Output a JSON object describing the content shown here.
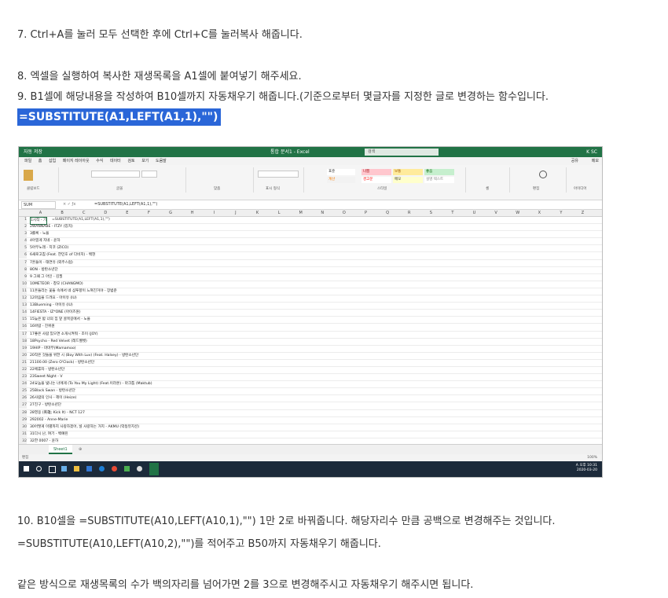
{
  "paragraphs": {
    "step7": "7. Ctrl+A를 눌러 모두 선택한 후에 Ctrl+C를 눌러복사 해줍니다.",
    "step8": "8. 엑셀을 실행하여 복사한 재생목록을 A1셀에 붙여넣기 해주세요.",
    "step9": "9. B1셀에 해당내용을 작성하여 B10셀까지 자동채우기 해줍니다.(기준으로부터 몇글자를 지정한 글로 변경하는 함수입니다.",
    "formula": "=SUBSTITUTE(A1,LEFT(A1,1),\"\")",
    "step10a": "10. B10셀을 =SUBSTITUTE(A10,LEFT(A10,1),\"\") 1만 2로 바꿔줍니다. 해당자리수 만큼 공백으로 변경해주는 것입니다.",
    "step10b": "=SUBSTITUTE(A10,LEFT(A10,2),\"\")를 적어주고 B50까지 자동채우기 해줍니다.",
    "step11": "같은 방식으로 재생목록의 수가 백의자리를 넘어가면 2를 3으로 변경해주시고 자동채우기 해주시면 됩니다."
  },
  "excel": {
    "autosave": "자동 저장",
    "window_title": "통합 문서1 - Excel",
    "search_placeholder": "검색",
    "user": "K SC",
    "menu": [
      "파일",
      "홈",
      "삽입",
      "페이지 레이아웃",
      "수식",
      "데이터",
      "검토",
      "보기",
      "도움말"
    ],
    "share": "공유",
    "memo": "메모",
    "ribbon_groups": [
      "클립보드",
      "글꼴",
      "맞춤",
      "표시 형식",
      "스타일",
      "셀",
      "편집",
      "아이디어"
    ],
    "style_cells": [
      "표준",
      "나쁨",
      "보통",
      "좋음",
      "계산",
      "경고문",
      "메모",
      "설명 텍스트"
    ],
    "name_box": "SUM",
    "formula_value": "=SUBSTITUTE(A1,LEFT(A1,1),\"\")",
    "columns": [
      "A",
      "B",
      "C",
      "D",
      "E",
      "F",
      "G",
      "H",
      "I",
      "J",
      "K",
      "L",
      "M",
      "N",
      "O",
      "P",
      "Q",
      "R",
      "S",
      "T",
      "U",
      "V",
      "W",
      "X",
      "Y",
      "Z"
    ],
    "rows": [
      "1시작 - 기",
      "2WANNABE - ITZY (있지)",
      "3롤록 - 노을",
      "4아낄게 지네 - 윤하",
      "5아무노래 - 지코 (ZICO)",
      "6새로고침 (Feat. 한민호 of 다비치) - 백현",
      "7흔들이 - 태연유 (외주스럼)",
      "8ON - 방탄소년단",
      "9 그때 그 아인 - 김필",
      "10METEOR - 창모 (CHANGMO)",
      "11흔들리는 꽃들 속에서 네 샴푸향이 느껴진거야 - 장범준",
      "12마음을 드려요 - 아이유 (IU)",
      "13Blueming - 아이유 (IU)",
      "14FIESTA - IZ*ONE (아이즈원)",
      "15늦은 밤 너의 집 앞 골목길에서 - 노을",
      "16바람 - 진위원",
      "17좋은 사람 있으면 소개시켜줘 - 조이 (JOY)",
      "18Psycho - Red Velvet (레드벨벳)",
      "19HIP - 마마무(Mamamoo)",
      "20작은 것들을 위한 시 (Boy With Luv) (Feat. Halsey) - 방탄소년단",
      "21100.00 (Zero O'Clock) - 방탄소년단",
      "22에휴자 - 방탄소년단",
      "23Sweet Night - V",
      "24요놈을 빛나는 너에게 (To You My Light) (Feat.이라온) - 마크툽 (Maktub)",
      "25Black Swan - 방탄소년단",
      "26사람의 인사 - 헤이 (Heize)",
      "27친구 - 방탄소년단",
      "28영웅 (英雄; Kick It) - NCT 127",
      "292002 - Anne-Marie",
      "30어떻게 이별까지 사랑하겠어, 널 사랑하는 거지 - AKMU (악동뮤지션)",
      "31다시 난, 여기 - 백예린",
      "32한 0007 - 윤하",
      "33잘 지내고 있는지 궁금해 - V.O.S",
      "34Moon - 방탄소년단",
      "35Filter - 방탄소년단"
    ],
    "sheet_tab": "Sheet1",
    "status_left": "편집",
    "zoom": "100%",
    "clock_time": "오후 10:31",
    "clock_date": "2020-03-20",
    "tray_lang": "A"
  }
}
